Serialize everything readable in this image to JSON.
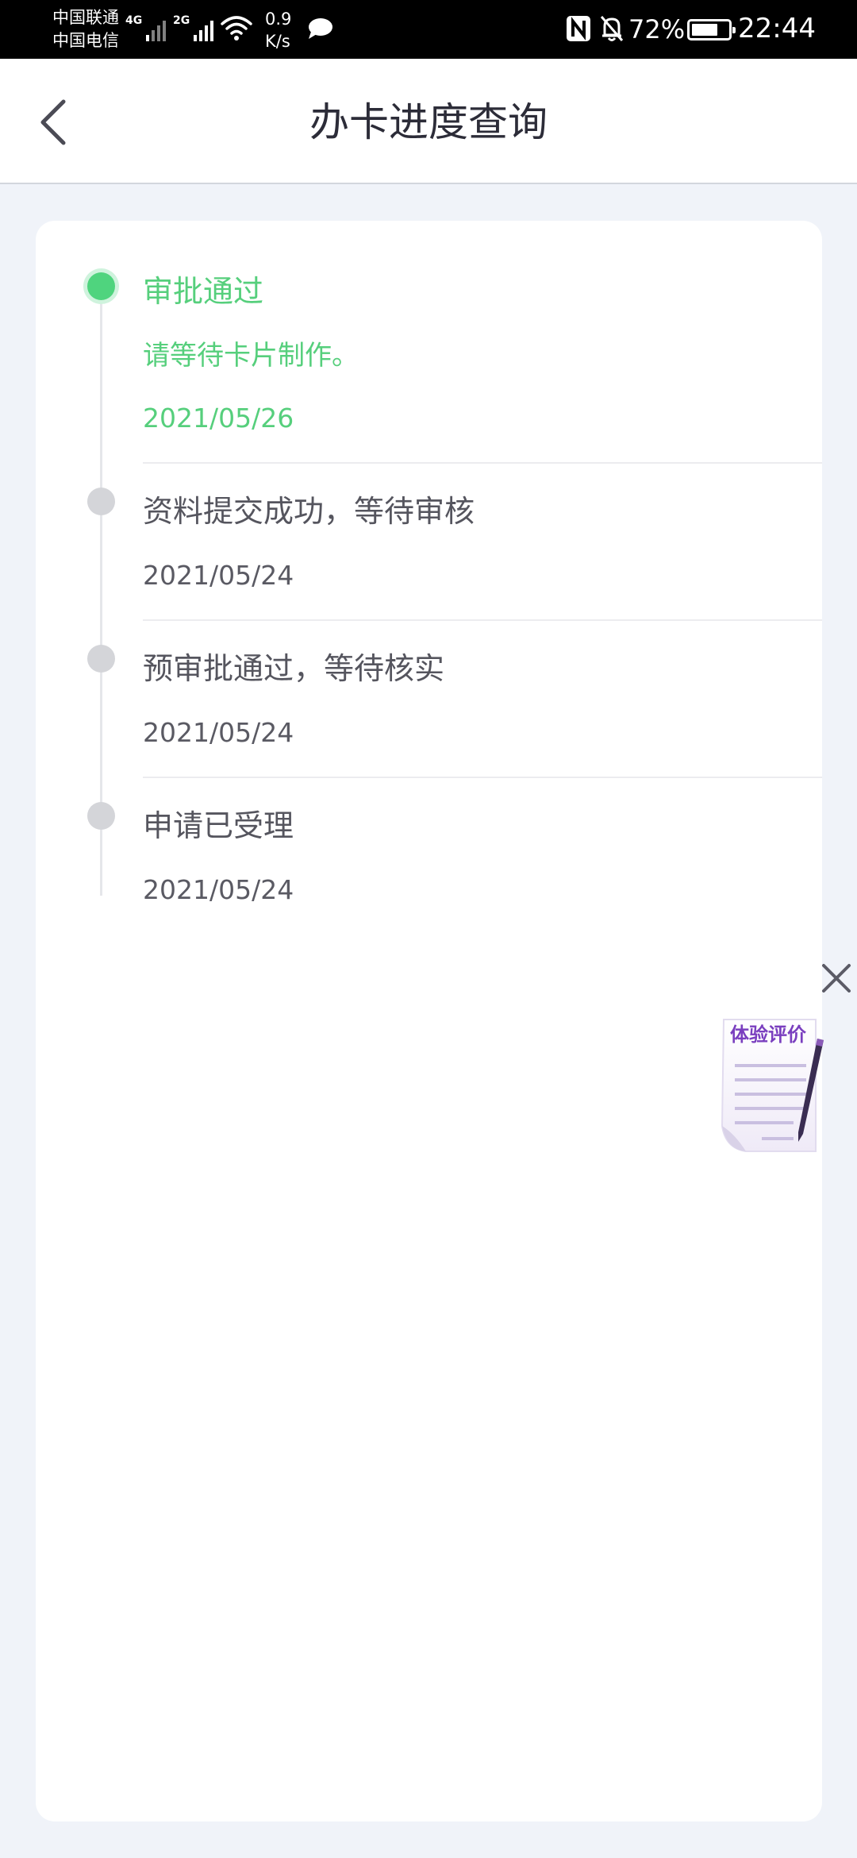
{
  "status_bar": {
    "carrier1": "中国联通",
    "carrier2": "中国电信",
    "sig1_tag": "4G",
    "sig2_tag": "2G",
    "speed_value": "0.9",
    "speed_unit": "K/s",
    "battery_pct": "72%",
    "battery_level": 0.72,
    "time": "22:44"
  },
  "header": {
    "title": "办卡进度查询"
  },
  "steps": [
    {
      "title": "审批通过",
      "desc": "请等待卡片制作。",
      "date": "2021/05/26",
      "active": true
    },
    {
      "title": "资料提交成功，等待审核",
      "date": "2021/05/24",
      "active": false
    },
    {
      "title": "预审批通过，等待核实",
      "date": "2021/05/24",
      "active": false
    },
    {
      "title": "申请已受理",
      "date": "2021/05/24",
      "active": false
    }
  ],
  "review_badge": {
    "label": "体验评价"
  },
  "colors": {
    "accent_green": "#56cf7c",
    "dot_gray": "#d4d5d9",
    "background": "#f0f3f9"
  }
}
